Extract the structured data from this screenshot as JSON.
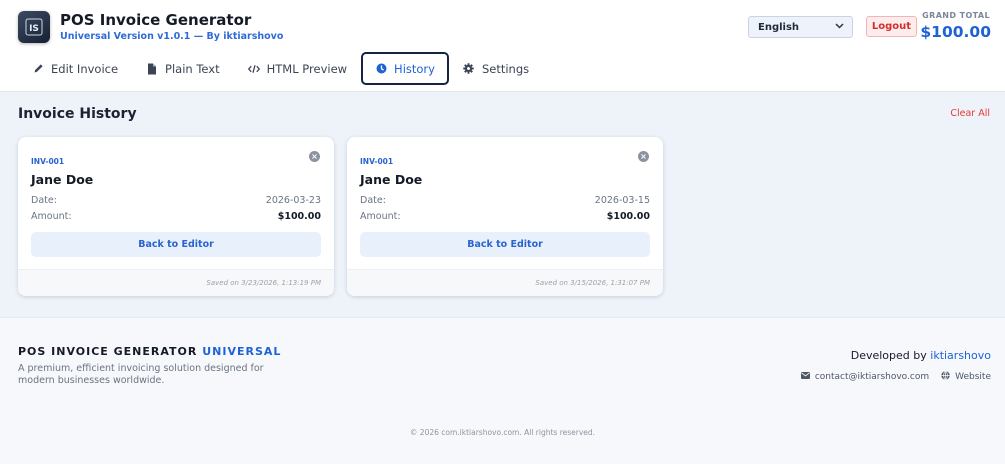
{
  "header": {
    "title": "POS Invoice Generator",
    "subtitle": "Universal Version v1.0.1 — By iktiarshovo",
    "language": "English",
    "logout_label": "Logout",
    "grand_total_label": "GRAND TOTAL",
    "grand_total_value": "$100.00"
  },
  "tabs": [
    {
      "label": "Edit Invoice",
      "icon": "pencil-icon"
    },
    {
      "label": "Plain Text",
      "icon": "document-icon"
    },
    {
      "label": "HTML Preview",
      "icon": "code-icon"
    },
    {
      "label": "History",
      "icon": "clock-icon",
      "active": true
    },
    {
      "label": "Settings",
      "icon": "gear-icon"
    }
  ],
  "history": {
    "title": "Invoice History",
    "clear_all_label": "Clear All",
    "cards": [
      {
        "invoice_no": "INV-001",
        "name": "Jane Doe",
        "date_label": "Date:",
        "date": "2026-03-23",
        "amount_label": "Amount:",
        "amount": "$100.00",
        "button_label": "Back to Editor",
        "saved": "Saved on 3/23/2026, 1:13:19 PM"
      },
      {
        "invoice_no": "INV-001",
        "name": "Jane Doe",
        "date_label": "Date:",
        "date": "2026-03-15",
        "amount_label": "Amount:",
        "amount": "$100.00",
        "button_label": "Back to Editor",
        "saved": "Saved on 3/15/2026, 1:31:07 PM"
      }
    ]
  },
  "footer": {
    "brand_main": "POS INVOICE GENERATOR",
    "brand_accent": "UNIVERSAL",
    "tagline": "A premium, efficient invoicing solution designed for modern businesses worldwide.",
    "developed_by": "Developed by",
    "developer": "iktiarshovo",
    "email": "contact@iktiarshovo.com",
    "website": "Website",
    "copyright": "© 2026 com.iktiarshovo.com. All rights reserved."
  },
  "colors": {
    "accent": "#1f62d6",
    "danger": "#e53935",
    "active_tab_border": "#152443"
  }
}
